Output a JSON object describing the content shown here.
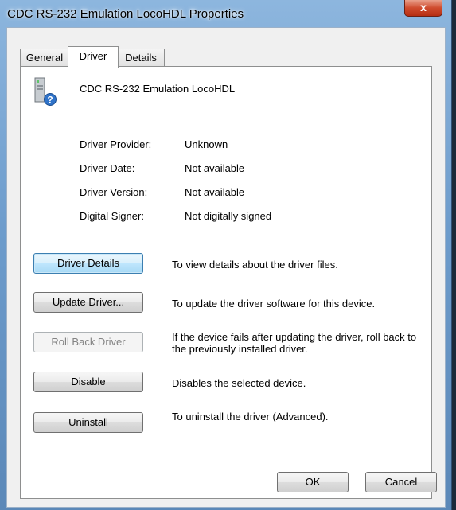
{
  "window": {
    "title": "CDC RS-232 Emulation LocoHDL Properties",
    "close_symbol": "x"
  },
  "tabs": [
    {
      "label": "General",
      "active": false
    },
    {
      "label": "Driver",
      "active": true
    },
    {
      "label": "Details",
      "active": false
    }
  ],
  "device": {
    "name": "CDC RS-232 Emulation LocoHDL",
    "icon": "serial-device-unknown-icon"
  },
  "info": [
    {
      "label": "Driver Provider:",
      "value": "Unknown"
    },
    {
      "label": "Driver Date:",
      "value": "Not available"
    },
    {
      "label": "Driver Version:",
      "value": "Not available"
    },
    {
      "label": "Digital Signer:",
      "value": "Not digitally signed"
    }
  ],
  "actions": [
    {
      "label": "Driver Details",
      "description": "To view details about the driver files.",
      "state": "focused"
    },
    {
      "label": "Update Driver...",
      "description": "To update the driver software for this device.",
      "state": "normal"
    },
    {
      "label": "Roll Back Driver",
      "description": "If the device fails after updating the driver, roll back to the previously installed driver.",
      "state": "disabled"
    },
    {
      "label": "Disable",
      "description": "Disables the selected device.",
      "state": "normal"
    },
    {
      "label": "Uninstall",
      "description": "To uninstall the driver (Advanced).",
      "state": "normal"
    }
  ],
  "footer": {
    "ok_label": "OK",
    "cancel_label": "Cancel"
  }
}
